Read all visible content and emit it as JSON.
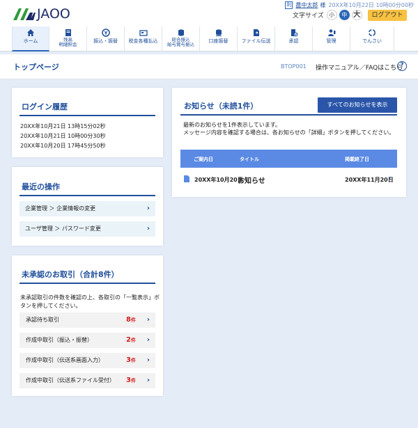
{
  "brand": {
    "name": "JA",
    "suffix": "OO",
    "green": "#2e9b3b",
    "navy": "#1d2b66"
  },
  "header": {
    "user_icon": "利",
    "user_name": "農中太郎",
    "user_suffix": "様",
    "last_login": "20XX年10月22日 10時00分00秒",
    "font_size_label": "文字サイズ",
    "font_sizes": [
      "小",
      "中",
      "大"
    ],
    "logout_label": "ログアウト"
  },
  "nav": {
    "items": [
      {
        "label": "ホーム",
        "icon": "home-icon",
        "active": true
      },
      {
        "label": "残高\n明細照会",
        "icon": "ledger-icon"
      },
      {
        "label": "振込・振替",
        "icon": "yen-transfer-icon"
      },
      {
        "label": "税金各種払込",
        "icon": "tax-payment-icon"
      },
      {
        "label": "総合振込\n給与賞与振込",
        "icon": "coin-stack-icon"
      },
      {
        "label": "口座振替",
        "icon": "account-transfer-icon"
      },
      {
        "label": "ファイル伝送",
        "icon": "file-transfer-icon"
      },
      {
        "label": "承認",
        "icon": "approval-icon"
      },
      {
        "label": "管理",
        "icon": "admin-icon"
      },
      {
        "label": "でんさい",
        "icon": "densai-icon"
      }
    ]
  },
  "page": {
    "title": "トップページ",
    "code": "BTOP001",
    "manual_link": "操作マニュアル／FAQはこちら",
    "help_icon": "?"
  },
  "login_history": {
    "title": "ログイン履歴",
    "entries": [
      "20XX年10月21日 13時15分02秒",
      "20XX年10月21日 10時00分30秒",
      "20XX年10月20日 17時45分50秒"
    ]
  },
  "recent_ops": {
    "title": "最近の操作",
    "items": [
      "企業管理 ＞ 企業情報の変更",
      "ユーザ管理 ＞ パスワード変更"
    ]
  },
  "pending": {
    "title": "未承認のお取引（合計8件）",
    "description": "未承認取引の件数を確認の上、各取引の「一覧表示」ボタンを押してください。",
    "unit": "件",
    "items": [
      {
        "label": "承認待ち取引",
        "count": "8"
      },
      {
        "label": "作成中取引（振込・振替）",
        "count": "2"
      },
      {
        "label": "作成中取引（伝送系画面入力）",
        "count": "3"
      },
      {
        "label": "作成中取引（伝送系ファイル受付）",
        "count": "3"
      }
    ]
  },
  "news": {
    "title": "お知らせ（未読1件）",
    "all_button": "すべてのお知らせを表示",
    "description_1": "最新のお知らせを1件表示しています。",
    "description_2": "メッセージ内容を確認する場合は、各お知らせの「詳細」ボタンを押してください。",
    "columns": {
      "date": "ご案内日",
      "title": "タイトル",
      "end": "掲載終了日"
    },
    "rows": [
      {
        "date": "20XX年10月20日",
        "title": "お知らせ",
        "end": "20XX年11月20日",
        "icon": "document-icon"
      }
    ]
  },
  "colors": {
    "accent": "#1f4f9a",
    "background": "#e4ecf8",
    "logout": "#f7c141",
    "count": "#d21d1d",
    "table_head": "#5b8ae4"
  }
}
